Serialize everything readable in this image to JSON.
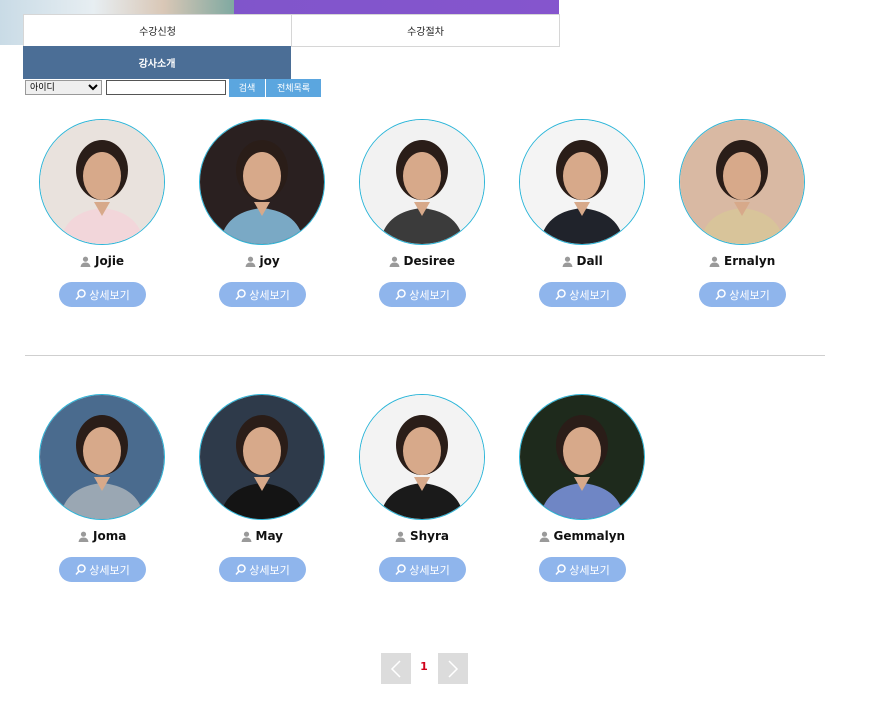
{
  "tabs": {
    "enroll": "수강신청",
    "procedure": "수강절차",
    "intro": "강사소개"
  },
  "search": {
    "select_value": "아이디",
    "input_value": "",
    "search_label": "검색",
    "all_label": "전체목록"
  },
  "teachers": [
    {
      "name": "Jojie",
      "detail": "상세보기"
    },
    {
      "name": "joy",
      "detail": "상세보기"
    },
    {
      "name": "Desiree",
      "detail": "상세보기"
    },
    {
      "name": "Dall",
      "detail": "상세보기"
    },
    {
      "name": "Ernalyn",
      "detail": "상세보기"
    },
    {
      "name": "Joma",
      "detail": "상세보기"
    },
    {
      "name": "May",
      "detail": "상세보기"
    },
    {
      "name": "Shyra",
      "detail": "상세보기"
    },
    {
      "name": "Gemmalyn",
      "detail": "상세보기"
    }
  ],
  "pagination": {
    "current_page": "1"
  },
  "colors": {
    "banner": "#8a55d0",
    "active_tab": "#4b6e96",
    "search_button": "#5ba6df",
    "detail_button": "#8fb5ec",
    "avatar_border": "#2bb5d8",
    "page_number": "#d0021b"
  },
  "icons": {
    "person": "person-icon",
    "magnifier": "search-icon",
    "prev": "chevron-left-icon",
    "next": "chevron-right-icon"
  }
}
